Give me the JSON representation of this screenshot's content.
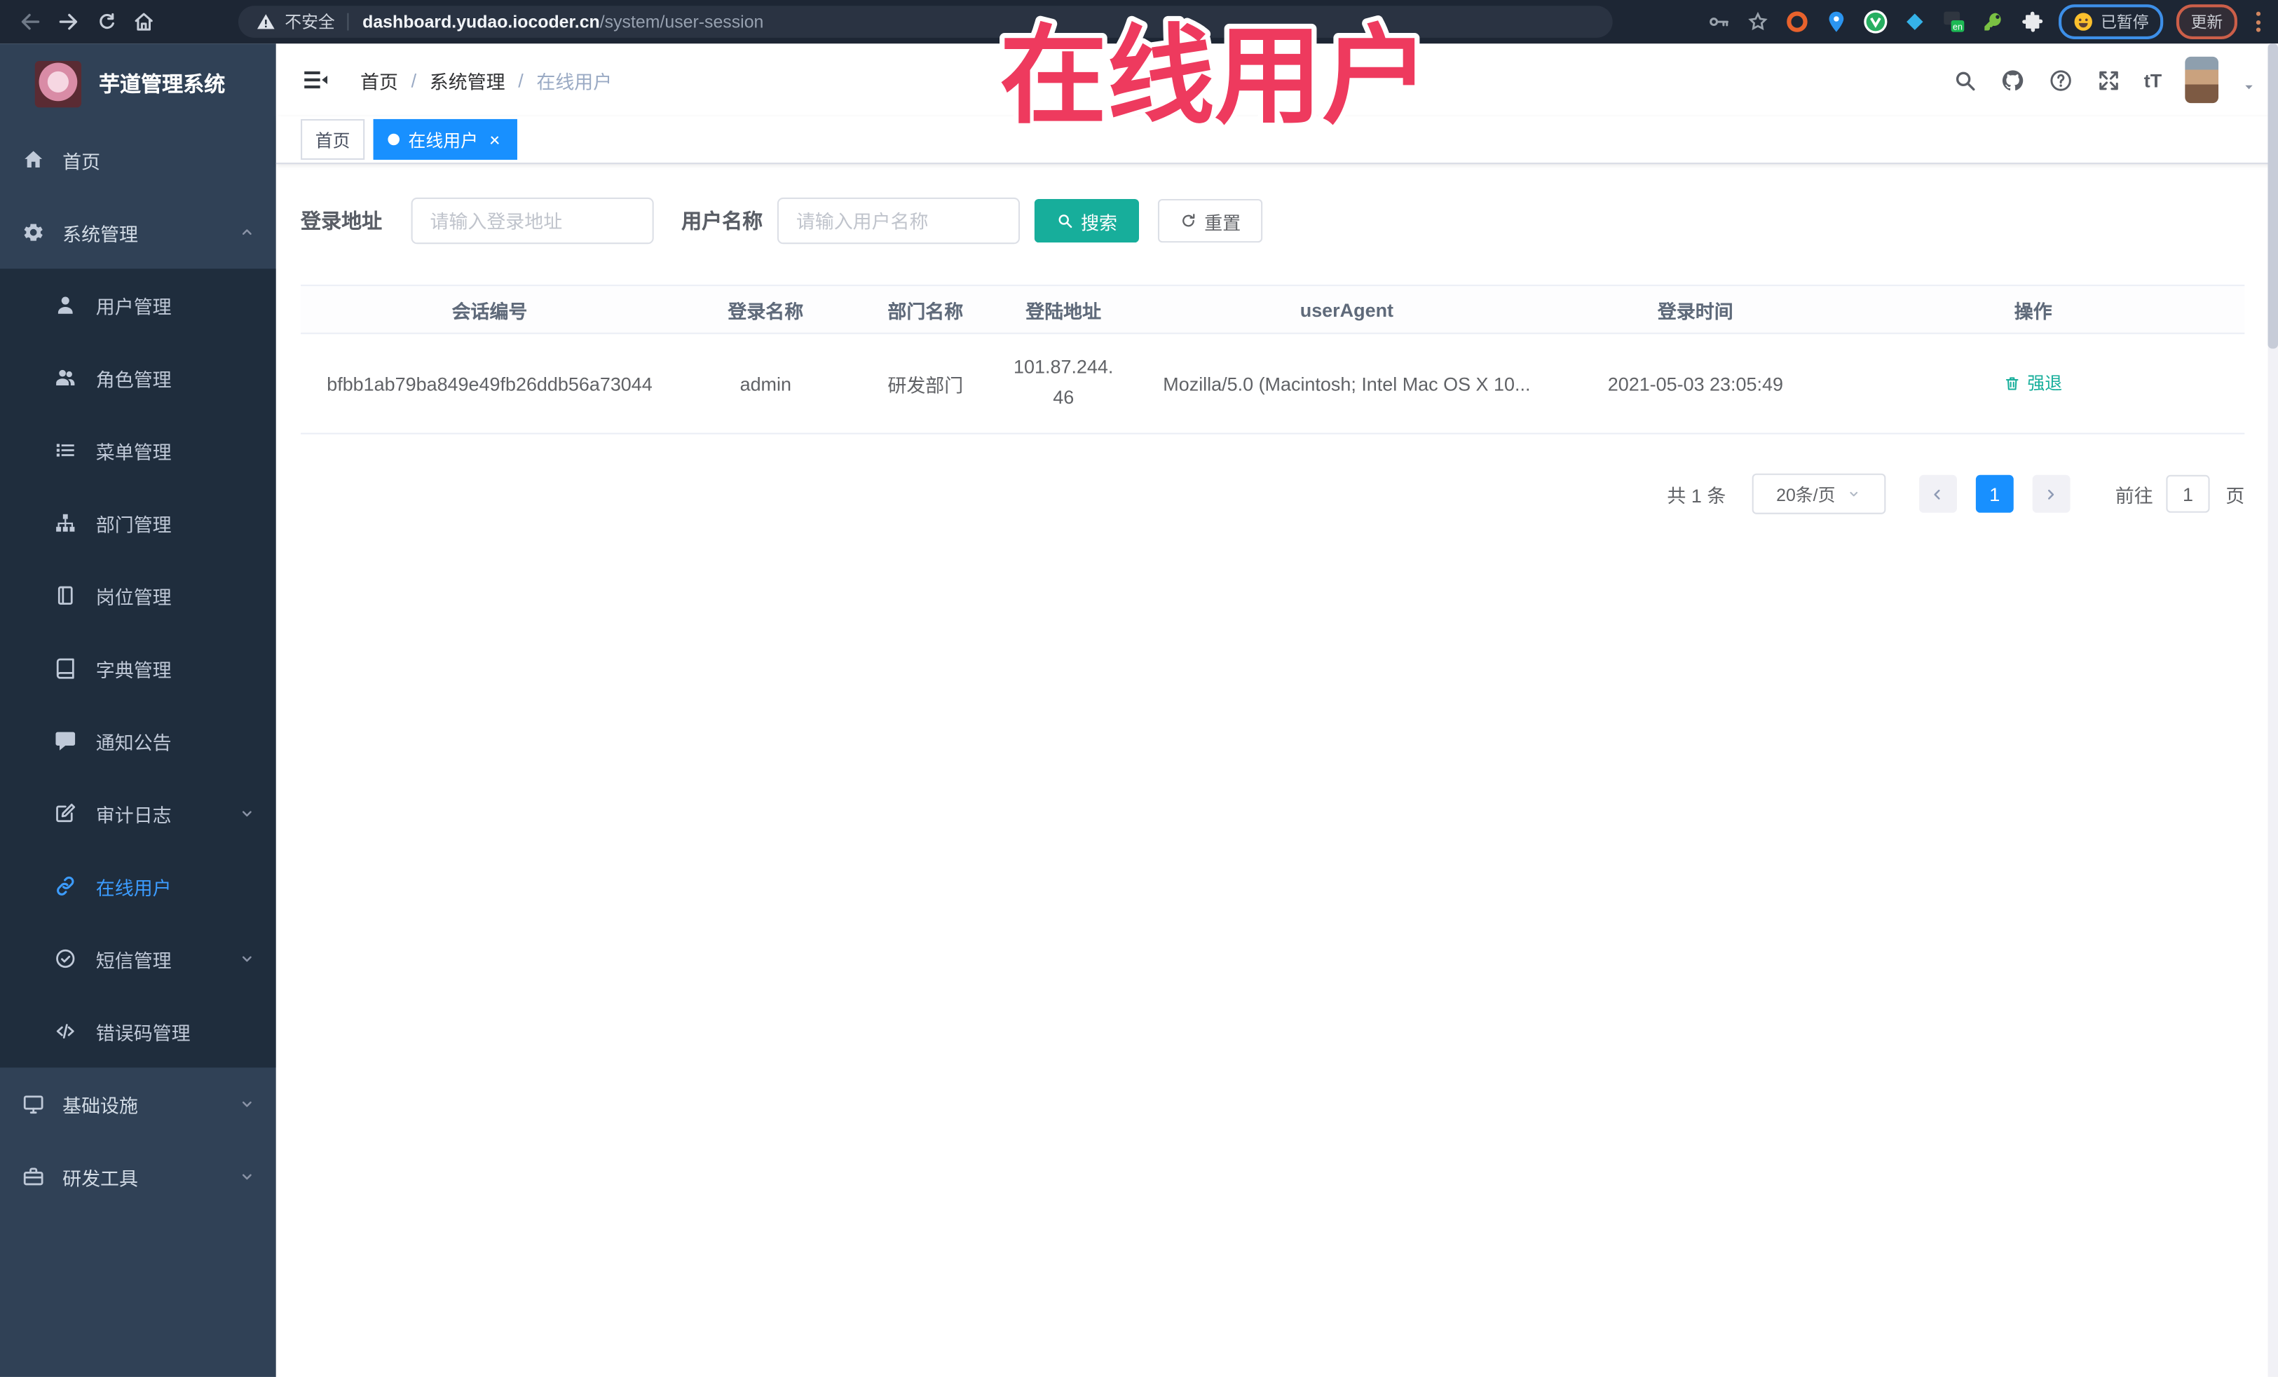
{
  "browser": {
    "security_label": "不安全",
    "url_host": "dashboard.yudao.iocoder.cn",
    "url_path": "/system/user-session",
    "paused_label": "已暂停",
    "update_label": "更新"
  },
  "annotation": {
    "text": "在线用户"
  },
  "sidebar": {
    "logo_title": "芋道管理系统",
    "items": [
      {
        "label": "首页"
      },
      {
        "label": "系统管理"
      },
      {
        "label": "用户管理"
      },
      {
        "label": "角色管理"
      },
      {
        "label": "菜单管理"
      },
      {
        "label": "部门管理"
      },
      {
        "label": "岗位管理"
      },
      {
        "label": "字典管理"
      },
      {
        "label": "通知公告"
      },
      {
        "label": "审计日志"
      },
      {
        "label": "在线用户"
      },
      {
        "label": "短信管理"
      },
      {
        "label": "错误码管理"
      },
      {
        "label": "基础设施"
      },
      {
        "label": "研发工具"
      }
    ]
  },
  "header": {
    "breadcrumb": [
      "首页",
      "系统管理",
      "在线用户"
    ],
    "breadcrumb_separator": "/",
    "font_size_label": "tT"
  },
  "tabs": [
    {
      "label": "首页"
    },
    {
      "label": "在线用户"
    }
  ],
  "filter": {
    "login_address_label": "登录地址",
    "login_address_placeholder": "请输入登录地址",
    "username_label": "用户名称",
    "username_placeholder": "请输入用户名称",
    "search_label": "搜索",
    "reset_label": "重置"
  },
  "table": {
    "columns": [
      "会话编号",
      "登录名称",
      "部门名称",
      "登陆地址",
      "userAgent",
      "登录时间",
      "操作"
    ],
    "rows": [
      {
        "session_id": "bfbb1ab79ba849e49fb26ddb56a73044",
        "username": "admin",
        "dept": "研发部门",
        "ip": "101.87.244.46",
        "user_agent": "Mozilla/5.0 (Macintosh; Intel Mac OS X 10...",
        "login_time": "2021-05-03 23:05:49",
        "action_label": "强退"
      }
    ]
  },
  "pagination": {
    "total_label": "共 1 条",
    "page_size": "20条/页",
    "current_page": "1",
    "goto_label": "前往",
    "goto_value": "1",
    "page_label": "页"
  },
  "colors": {
    "accent_blue": "#1890ff",
    "theme_teal": "#17ae9b",
    "annotation_red": "#ee3a5e",
    "sidebar_bg": "#304156",
    "submenu_bg": "#1f2d3d",
    "chrome_bg": "#1d2634"
  }
}
